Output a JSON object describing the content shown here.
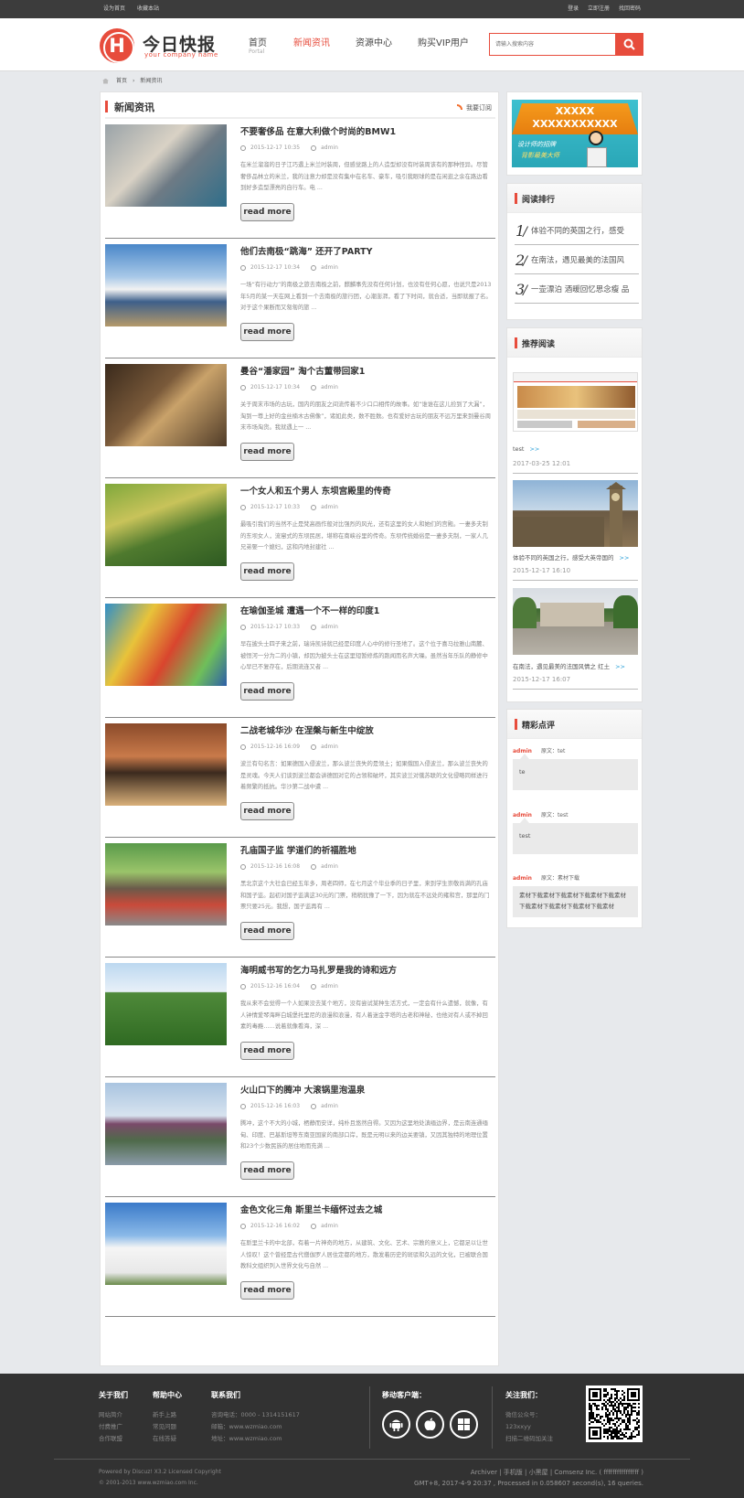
{
  "topbar": {
    "set_home": "设为首页",
    "bookmark": "收藏本站",
    "login": "登录",
    "register": "立即注册",
    "forgot": "找回密码"
  },
  "header": {
    "logo_letter": "H",
    "logo_title": "今日快报",
    "logo_sub": "your company name",
    "nav": [
      {
        "label": "首页",
        "sub": "Portal"
      },
      {
        "label": "新闻资讯"
      },
      {
        "label": "资源中心"
      },
      {
        "label": "购买VIP用户"
      }
    ],
    "search_placeholder": "请输入搜索内容"
  },
  "breadcrumb": [
    "首页",
    "新闻资讯"
  ],
  "main": {
    "title": "新闻资讯",
    "subscribe": "我要订阅",
    "more_label": "read more",
    "author": "admin",
    "articles": [
      {
        "title": "不要奢侈品 在意大利做个时尚的BMW1",
        "date": "2015-12-17 10:35",
        "summary": "在米兰溜溜的日子江巧遇上米兰时装周，但感觉路上的人造型却没有时装周该有的那种怪异。尽管奢侈品林立的米兰，我的注意力却是没有集中在名车、豪车，吸引我眼球的是在闲逛之余在路边看到好多造型漂亮的自行车。电 ..."
      },
      {
        "title": "他们去南极“跳海” 还开了PARTY",
        "date": "2015-12-17 10:34",
        "summary": "一场“有行动力”的南极之旅去南极之前，麒麟事先没有任何计划，也没有任何心愿，也说只是2013年5月的某一天在网上看到一个去南极的旅行团，心潮澎湃，看了下时间，就合适，当即就报了名。对于这个果断而又匆匆的旅 ..."
      },
      {
        "title": "曼谷“潘家园” 淘个古董带回家1",
        "date": "2015-12-17 10:34",
        "summary": "关于周末市场的古玩，国内的朋友之间流传着不少口口相传的故事。如“谁谁在这儿捡到了大漏”，淘到一尊上好的金丝楠木古佛像”，诸如此类，数不胜数。也有爱好古玩的朋友不远万里来到曼谷周末市场淘货。我就遇上一 ..."
      },
      {
        "title": "一个女人和五个男人 东坝宫殿里的传奇",
        "date": "2015-12-17 10:33",
        "summary": "最吸引我们的当然不止是梵高画作般对比强烈的风光，还有这里的女人和她们的宫殿。一妻多夫制的东坝女人，流窜式的东坝民居，堪称在南峡谷里的传奇。东坝传统婚俗是一妻多夫制，一家人几兄弟娶一个媳妇，这和内地封建社 ..."
      },
      {
        "title": "在瑜伽圣城 遭遇一个不一样的印度1",
        "date": "2015-12-17 10:33",
        "summary": "早在披头士四子来之前，瑞诗凯诗就已经是印度人心中的修行圣地了。这个位于喜马拉雅山南麓、被恒河一分为二的小镇，却因为披头士在这里短暂修炼的跑闻而名声大噪。虽然当年乐队的静修中心早已不复存在，后期流连又者 ..."
      },
      {
        "title": "二战老城华沙 在涅槃与新生中绽放",
        "date": "2015-12-16 16:09",
        "summary": "波兰有句名言：如果德国入侵波兰，那么波兰丧失的是领土；如果俄国入侵波兰，那么波兰丧失的是灵魂。今天人们谈到波兰都会讲德国对它的占领和破坏，其实波兰对俄苏联的文化侵略同样进行着频繁的抵抗。华沙第二战中遭 ..."
      },
      {
        "title": "孔庙国子监 学道们的祈福胜地",
        "date": "2015-12-16 16:08",
        "summary": "黑北京这个大社会已经五年多，周老四师，在七月这个毕业季的日子里，来到学生崇敬尚满的孔庙和国子监。起初对国子监满这30元的门票，稍稍犹豫了一下，因为就在不远处的雍和宫，那里的门票只要25元。我想，国子监再有 ..."
      },
      {
        "title": "海明威书写的乞力马扎罗是我的诗和远方",
        "date": "2015-12-16 16:04",
        "summary": "我从来不会觉得一个人如果没去某个地方，没有尝试某种生活方式，一定会有什么遗憾，就像，有人钟情爱琴海畔白城堡托里尼的浪漫和浪漫，有人着迷金字塔的古老和神秘，也他对有人或不掉回素的毒瘾……说着就像看海，深 ..."
      },
      {
        "title": "火山口下的腾冲 大滚锅里泡温泉",
        "date": "2015-12-16 16:03",
        "summary": "腾冲，这个不大的小城，栖静而安详，纯朴且悠然自得。又因为这里地处滇缅边界，是云南连通缅甸、印度、巴基斯坦等东南亚国家的南部口岸，既是元明以来的边关要镇，又因其独特的地理位置和23个少数民族的居住地而充满 ..."
      },
      {
        "title": "金色文化三角 斯里兰卡缅怀过去之城",
        "date": "2015-12-16 16:02",
        "summary": "在斯里兰卡的中北部，有着一片神奇的地方，从建筑、文化、艺术、宗教的意义上，它都足以让世人惊叹！这个曾经是古代僧伽罗人居住定都的地方，散发着历史的斑驳和久远的文化，已被联合国教科文组织列入世界文化与自然 ..."
      }
    ]
  },
  "sidebar": {
    "banner": {
      "line1": "XXXXX",
      "line2": "XXXXXXXXXXX",
      "line3": "设计师的招牌",
      "line4": "背影最美大师"
    },
    "ranking_title": "阅读排行",
    "ranking": [
      {
        "n": "1",
        "text": "体验不同的英国之行，感受"
      },
      {
        "n": "2",
        "text": "在南法，遇见最美的法国风"
      },
      {
        "n": "3",
        "text": "一壶漂泊 酒暖回忆思念瘦 品"
      }
    ],
    "rec_title": "推荐阅读",
    "recs": [
      {
        "caption": "test",
        "arrow": ">>",
        "date": "2017-03-25 12:01"
      },
      {
        "caption": "体验不同的英国之行，感受大英帝国的",
        "arrow": ">>",
        "date": "2015-12-17 16:10"
      },
      {
        "caption": "在南法，遇见最美的法国风情之 红土",
        "arrow": ">>",
        "date": "2015-12-17 16:07"
      }
    ],
    "comment_title": "精彩点评",
    "comments": [
      {
        "user": "admin",
        "src": "原文：tet",
        "body": "te"
      },
      {
        "user": "admin",
        "src": "原文：test",
        "body": "test"
      },
      {
        "user": "admin",
        "src": "原文：素材下载",
        "body": "素材下载素材下载素材下载素材下载素材下载素材下载素材下载素材下载素材"
      }
    ]
  },
  "footer": {
    "about": {
      "title": "关于我们",
      "items": [
        "网站简介",
        "付费推广",
        "合作联盟"
      ]
    },
    "help": {
      "title": "帮助中心",
      "items": [
        "新手上路",
        "常见问题",
        "在线答疑"
      ]
    },
    "contact": {
      "title": "联系我们",
      "items": [
        "咨询电话：0000 - 1314151617",
        "邮箱：www.wzmiao.com",
        "地址：www.wzmiao.com"
      ]
    },
    "mobile": {
      "title": "移动客户端："
    },
    "follow": {
      "title": "关注我们：",
      "items": [
        "微信公众号：",
        "123xxyy",
        "扫描二维码加关注"
      ]
    },
    "powered": "Powered by Discuz! X3.2 Licensed Copyright",
    "copyright": "© 2001-2013 www.wzmiao.com Inc.",
    "links": "Archiver | 手机版 | 小黑屋 | Comsenz Inc. ( ffffffffffffffff )",
    "stats": "GMT+8, 2017-4-9 20:37 , Processed in 0.058607 second(s), 16 queries."
  }
}
